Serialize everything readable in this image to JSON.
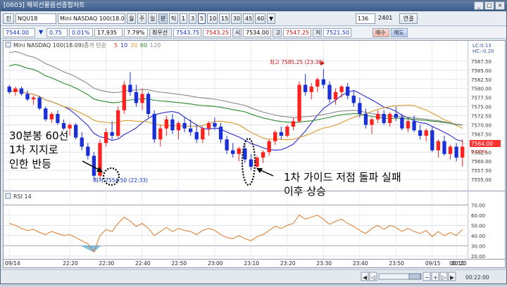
{
  "window": {
    "title": "[0603] 해외선물옵션종합차트",
    "buttons": [
      "_",
      "□",
      "×"
    ]
  },
  "toolbar": {
    "menu": "진",
    "symbol": "NQU18",
    "name": "Mini NASDAQ 100(18.0",
    "period_tabs": [
      "월",
      "주",
      "일",
      "분",
      "틱"
    ],
    "minute_values": [
      "1",
      "3",
      "5",
      "10",
      "15",
      "30",
      "45",
      "60"
    ],
    "selected_minute": "5",
    "count_value": "136",
    "count_total": "2401",
    "apply_label": "연결",
    "extra": "▼"
  },
  "quote": {
    "price": "7544.00",
    "arrow": "▼",
    "change": "0.75",
    "change_pct": "0.01%",
    "volume": "17,935",
    "ratio": "7.79%",
    "best_label": "최우선",
    "best_ask": "7543.75",
    "best_bid": "7543.25",
    "open_label": "시",
    "open": "7534.00",
    "high_label": "고",
    "high": "7547.25",
    "low_label": "저",
    "low": "7521.50",
    "sell_label": "매수",
    "buy_label": "매도"
  },
  "chart_header": {
    "title": "Mini NASDAQ 100(18.09)",
    "ma_label": "종가 단순",
    "ma_periods": [
      "5",
      "10",
      "20",
      "60",
      "120"
    ],
    "ma_colors": [
      "#ff2a2a",
      "#2b2bcc",
      "#d89a2a",
      "#2a8a2a",
      "#8a8a8a"
    ],
    "rsi_label": "RSI 14",
    "right_top_1": "LC:0.13",
    "right_top_2": "HC:-0.20"
  },
  "chart_data": [
    {
      "type": "candlestick",
      "title": "Mini NASDAQ 100(18.09)",
      "xlabel": "",
      "ylabel": "",
      "ylim": [
        7552.5,
        7590
      ],
      "yticks": [
        7555.0,
        7557.5,
        7560.0,
        7562.5,
        7565.0,
        7567.5,
        7570.0,
        7572.5,
        7575.0,
        7577.5,
        7580.0,
        7582.5,
        7585.0,
        7587.5
      ],
      "ytick_labels": [
        "7555.00",
        "7557.50",
        "7560.00",
        "7562.50",
        "7565.00",
        "7567.50",
        "7570.00",
        "7572.50",
        "7575.00",
        "7577.50",
        "7580.00",
        "7582.50",
        "7585.00",
        "7587.50"
      ],
      "candles": [
        [
          7580.5,
          7581.0,
          7578.5,
          7579.0
        ],
        [
          7579.0,
          7580.5,
          7578.0,
          7580.0
        ],
        [
          7580.0,
          7580.5,
          7578.0,
          7578.5
        ],
        [
          7578.5,
          7579.5,
          7576.5,
          7577.0
        ],
        [
          7577.0,
          7578.0,
          7575.5,
          7577.5
        ],
        [
          7577.5,
          7578.0,
          7574.0,
          7574.5
        ],
        [
          7574.5,
          7575.0,
          7571.0,
          7571.5
        ],
        [
          7571.5,
          7573.5,
          7570.5,
          7573.0
        ],
        [
          7573.0,
          7574.0,
          7570.0,
          7570.5
        ],
        [
          7570.5,
          7571.5,
          7568.5,
          7569.0
        ],
        [
          7569.0,
          7570.5,
          7567.0,
          7570.0
        ],
        [
          7570.0,
          7570.5,
          7566.0,
          7566.5
        ],
        [
          7566.5,
          7568.0,
          7563.0,
          7564.0
        ],
        [
          7564.0,
          7565.0,
          7560.5,
          7561.5
        ],
        [
          7561.5,
          7562.5,
          7554.5,
          7556.0
        ],
        [
          7556.0,
          7566.0,
          7555.0,
          7565.0
        ],
        [
          7565.0,
          7569.0,
          7564.0,
          7568.0
        ],
        [
          7568.0,
          7571.0,
          7566.0,
          7567.0
        ],
        [
          7567.0,
          7575.0,
          7566.5,
          7574.0
        ],
        [
          7574.0,
          7582.0,
          7573.0,
          7581.0
        ],
        [
          7581.0,
          7584.5,
          7578.0,
          7579.0
        ],
        [
          7579.0,
          7581.0,
          7575.0,
          7576.0
        ],
        [
          7576.0,
          7580.0,
          7574.0,
          7578.5
        ],
        [
          7578.5,
          7579.0,
          7572.0,
          7573.0
        ],
        [
          7573.0,
          7574.0,
          7565.0,
          7566.0
        ],
        [
          7566.0,
          7570.0,
          7564.0,
          7569.0
        ],
        [
          7569.0,
          7572.5,
          7567.0,
          7571.5
        ],
        [
          7571.5,
          7573.0,
          7567.5,
          7568.5
        ],
        [
          7568.5,
          7571.0,
          7566.0,
          7570.5
        ],
        [
          7570.5,
          7572.0,
          7568.0,
          7569.0
        ],
        [
          7569.0,
          7571.5,
          7567.0,
          7568.0
        ],
        [
          7568.0,
          7570.0,
          7565.0,
          7566.0
        ],
        [
          7566.0,
          7569.5,
          7565.0,
          7569.0
        ],
        [
          7569.0,
          7571.0,
          7567.0,
          7570.5
        ],
        [
          7570.5,
          7572.0,
          7568.5,
          7569.5
        ],
        [
          7569.5,
          7570.5,
          7565.0,
          7566.0
        ],
        [
          7566.0,
          7567.0,
          7562.0,
          7563.0
        ],
        [
          7563.0,
          7565.0,
          7561.0,
          7562.0
        ],
        [
          7562.0,
          7564.0,
          7560.0,
          7563.5
        ],
        [
          7563.5,
          7564.5,
          7559.5,
          7560.5
        ],
        [
          7560.5,
          7562.0,
          7557.5,
          7558.5
        ],
        [
          7558.5,
          7561.5,
          7558.0,
          7561.0
        ],
        [
          7561.0,
          7563.0,
          7559.5,
          7562.5
        ],
        [
          7562.5,
          7566.0,
          7561.5,
          7565.5
        ],
        [
          7565.5,
          7568.5,
          7564.5,
          7568.0
        ],
        [
          7568.0,
          7569.5,
          7566.0,
          7567.0
        ],
        [
          7567.0,
          7570.0,
          7566.5,
          7569.5
        ],
        [
          7569.5,
          7572.0,
          7568.5,
          7571.0
        ],
        [
          7571.0,
          7582.0,
          7570.5,
          7581.0
        ],
        [
          7581.0,
          7584.0,
          7578.0,
          7579.0
        ],
        [
          7579.0,
          7581.5,
          7577.0,
          7580.5
        ],
        [
          7580.5,
          7583.0,
          7579.0,
          7582.5
        ],
        [
          7582.5,
          7585.25,
          7580.0,
          7581.0
        ],
        [
          7581.0,
          7582.0,
          7576.0,
          7577.0
        ],
        [
          7577.0,
          7580.0,
          7575.5,
          7579.0
        ],
        [
          7579.0,
          7581.0,
          7577.5,
          7580.5
        ],
        [
          7580.5,
          7581.5,
          7577.0,
          7578.0
        ],
        [
          7578.0,
          7579.5,
          7575.0,
          7576.0
        ],
        [
          7576.0,
          7577.5,
          7572.0,
          7573.0
        ],
        [
          7573.0,
          7574.5,
          7569.0,
          7570.0
        ],
        [
          7570.0,
          7572.0,
          7567.5,
          7571.5
        ],
        [
          7571.5,
          7574.0,
          7570.5,
          7573.0
        ],
        [
          7573.0,
          7574.0,
          7570.0,
          7570.5
        ],
        [
          7570.5,
          7573.5,
          7569.5,
          7573.0
        ],
        [
          7573.0,
          7575.0,
          7571.0,
          7572.0
        ],
        [
          7572.0,
          7573.0,
          7568.5,
          7569.0
        ],
        [
          7569.0,
          7571.5,
          7568.0,
          7571.0
        ],
        [
          7571.0,
          7572.5,
          7568.0,
          7568.5
        ],
        [
          7568.5,
          7570.0,
          7566.0,
          7567.0
        ],
        [
          7567.0,
          7569.0,
          7565.5,
          7568.5
        ],
        [
          7568.5,
          7569.5,
          7562.5,
          7563.0
        ],
        [
          7563.0,
          7566.0,
          7561.0,
          7565.5
        ],
        [
          7565.5,
          7567.0,
          7561.5,
          7562.0
        ],
        [
          7562.0,
          7564.5,
          7560.5,
          7564.0
        ],
        [
          7564.0,
          7565.0,
          7560.0,
          7561.0
        ],
        [
          7561.0,
          7566.0,
          7558.5,
          7564.0
        ]
      ],
      "ma5_color": "#ff2a2a",
      "annotations": {
        "high_label": "최고 7585.25 (23:38)",
        "low_label": "최저 7554.50 (22:33)",
        "last_price": "7564.00",
        "last_change": "0.00%"
      }
    },
    {
      "type": "line",
      "title": "RSI 14",
      "ylim": [
        20,
        75
      ],
      "yticks": [
        20.0,
        30.0,
        40.0,
        50.0,
        60.0,
        70.0
      ],
      "ytick_labels": [
        "20.00",
        "30.00",
        "40.00",
        "50.00",
        "60.00",
        "70.00"
      ],
      "series": [
        {
          "name": "RSI 14",
          "values": [
            52,
            50,
            47,
            45,
            46,
            43,
            41,
            44,
            42,
            40,
            41,
            38,
            35,
            32,
            24,
            40,
            46,
            44,
            52,
            58,
            54,
            49,
            52,
            47,
            40,
            44,
            48,
            44,
            47,
            45,
            44,
            41,
            45,
            47,
            45,
            41,
            38,
            37,
            40,
            37,
            35,
            39,
            41,
            45,
            49,
            47,
            50,
            52,
            60,
            56,
            58,
            60,
            56,
            51,
            54,
            56,
            52,
            49,
            45,
            42,
            47,
            50,
            46,
            50,
            48,
            44,
            47,
            44,
            42,
            45,
            39,
            44,
            40,
            43,
            40,
            46
          ]
        }
      ]
    }
  ],
  "x_axis": {
    "ticks": [
      "09/14",
      "22:20",
      "22:30",
      "22:40",
      "22:50",
      "23:00",
      "23:10",
      "23:20",
      "23:30",
      "23:40",
      "23:50",
      "09/15",
      "00:10",
      "00:20"
    ],
    "tick_index": [
      0,
      10,
      16,
      22,
      28,
      34,
      40,
      46,
      52,
      58,
      64,
      70,
      74,
      76
    ],
    "last_time": "00:22:00"
  },
  "annotations": {
    "left_lines": [
      "30분봉 60선",
      "1차 지지로",
      "인한 반등"
    ],
    "right_lines": [
      "1차 가이드 저점 돌파 실패",
      "이후 상승"
    ]
  }
}
